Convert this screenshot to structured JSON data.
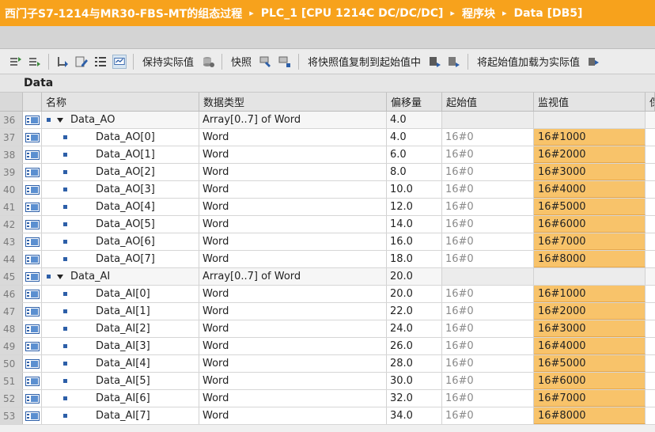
{
  "breadcrumb": {
    "project": "西门子S7-1214与MR30-FBS-MT的组态过程",
    "device": "PLC_1 [CPU 1214C DC/DC/DC]",
    "folder": "程序块",
    "block": "Data [DB5]",
    "separator": "▸"
  },
  "toolbar": {
    "keep_actual": "保持实际值",
    "snapshot": "快照",
    "copy_snapshot": "将快照值复制到起始值中",
    "load_start": "将起始值加载为实际值"
  },
  "section_title": "Data",
  "columns": {
    "name": "名称",
    "datatype": "数据类型",
    "offset": "偏移量",
    "start": "起始值",
    "monitor": "监视值",
    "more": "保"
  },
  "rows": [
    {
      "num": "36",
      "name": "Data_AO",
      "type": "Array[0..7] of Word",
      "offset": "4.0",
      "start": "",
      "monitor": "",
      "parent": true
    },
    {
      "num": "37",
      "name": "Data_AO[0]",
      "type": "Word",
      "offset": "4.0",
      "start": "16#0",
      "monitor": "16#1000"
    },
    {
      "num": "38",
      "name": "Data_AO[1]",
      "type": "Word",
      "offset": "6.0",
      "start": "16#0",
      "monitor": "16#2000"
    },
    {
      "num": "39",
      "name": "Data_AO[2]",
      "type": "Word",
      "offset": "8.0",
      "start": "16#0",
      "monitor": "16#3000"
    },
    {
      "num": "40",
      "name": "Data_AO[3]",
      "type": "Word",
      "offset": "10.0",
      "start": "16#0",
      "monitor": "16#4000"
    },
    {
      "num": "41",
      "name": "Data_AO[4]",
      "type": "Word",
      "offset": "12.0",
      "start": "16#0",
      "monitor": "16#5000"
    },
    {
      "num": "42",
      "name": "Data_AO[5]",
      "type": "Word",
      "offset": "14.0",
      "start": "16#0",
      "monitor": "16#6000"
    },
    {
      "num": "43",
      "name": "Data_AO[6]",
      "type": "Word",
      "offset": "16.0",
      "start": "16#0",
      "monitor": "16#7000"
    },
    {
      "num": "44",
      "name": "Data_AO[7]",
      "type": "Word",
      "offset": "18.0",
      "start": "16#0",
      "monitor": "16#8000"
    },
    {
      "num": "45",
      "name": "Data_AI",
      "type": "Array[0..7] of Word",
      "offset": "20.0",
      "start": "",
      "monitor": "",
      "parent": true
    },
    {
      "num": "46",
      "name": "Data_AI[0]",
      "type": "Word",
      "offset": "20.0",
      "start": "16#0",
      "monitor": "16#1000"
    },
    {
      "num": "47",
      "name": "Data_AI[1]",
      "type": "Word",
      "offset": "22.0",
      "start": "16#0",
      "monitor": "16#2000"
    },
    {
      "num": "48",
      "name": "Data_AI[2]",
      "type": "Word",
      "offset": "24.0",
      "start": "16#0",
      "monitor": "16#3000"
    },
    {
      "num": "49",
      "name": "Data_AI[3]",
      "type": "Word",
      "offset": "26.0",
      "start": "16#0",
      "monitor": "16#4000"
    },
    {
      "num": "50",
      "name": "Data_AI[4]",
      "type": "Word",
      "offset": "28.0",
      "start": "16#0",
      "monitor": "16#5000"
    },
    {
      "num": "51",
      "name": "Data_AI[5]",
      "type": "Word",
      "offset": "30.0",
      "start": "16#0",
      "monitor": "16#6000"
    },
    {
      "num": "52",
      "name": "Data_AI[6]",
      "type": "Word",
      "offset": "32.0",
      "start": "16#0",
      "monitor": "16#7000"
    },
    {
      "num": "53",
      "name": "Data_AI[7]",
      "type": "Word",
      "offset": "34.0",
      "start": "16#0",
      "monitor": "16#8000"
    }
  ],
  "colors": {
    "title_bar": "#f7a21c",
    "monitor_highlight": "#f8c36a"
  }
}
